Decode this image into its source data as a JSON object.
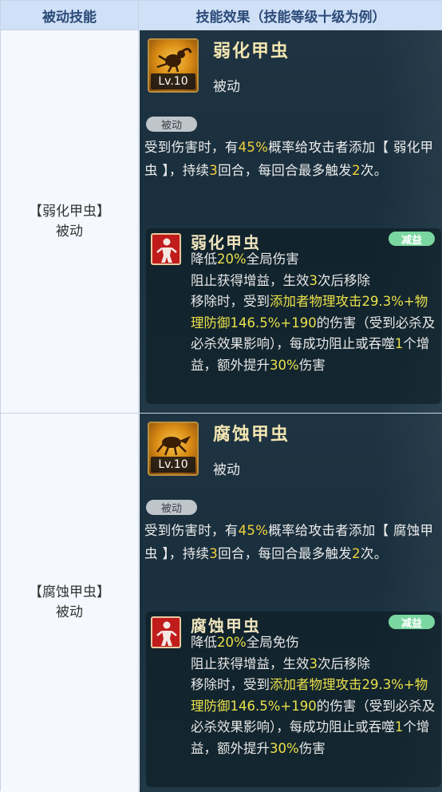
{
  "headers": {
    "col1": "被动技能",
    "col2": "技能效果（技能等级十级为例）"
  },
  "rows": [
    {
      "left_name": "【弱化甲虫】",
      "left_type": "被动",
      "skill_name": "弱化甲虫",
      "level": "Lv.10",
      "skill_type": "被动",
      "tag": "被动",
      "desc": {
        "p1": "受到伤害时，有",
        "v1": "45%",
        "p2": "概率给攻击者添加【 弱化甲虫 】，持续",
        "v2": "3",
        "p3": "回合，每回合最多触发",
        "v3": "2",
        "p4": "次。"
      },
      "buff": {
        "name": "弱化甲虫",
        "badge": "减益",
        "l1a": "降低",
        "l1v": "20%",
        "l1b": "全局伤害",
        "l2a": "阻止获得增益，生效",
        "l2v": "3",
        "l2b": "次后移除",
        "l3a": "移除时，受到",
        "l3v": "添加者物理攻击29.3%+物理防御146.5%+190",
        "l3b": "的伤害（受到必杀及必杀效果影响），每成功阻止或吞噬",
        "l3v2": "1",
        "l3c": "个增益，额外提升",
        "l3v3": "30%",
        "l3d": "伤害"
      }
    },
    {
      "left_name": "【腐蚀甲虫】",
      "left_type": "被动",
      "skill_name": "腐蚀甲虫",
      "level": "Lv.10",
      "skill_type": "被动",
      "tag": "被动",
      "desc": {
        "p1": "受到伤害时，有",
        "v1": "45%",
        "p2": "概率给攻击者添加【 腐蚀甲虫 】，持续",
        "v2": "3",
        "p3": "回合，每回合最多触发",
        "v3": "2",
        "p4": "次。"
      },
      "buff": {
        "name": "腐蚀甲虫",
        "badge": "减益",
        "l1a": "降低",
        "l1v": "20%",
        "l1b": "全局免伤",
        "l2a": "阻止获得增益，生效",
        "l2v": "3",
        "l2b": "次后移除",
        "l3a": "移除时，受到",
        "l3v": "添加者物理攻击29.3%+物理防御146.5%+190",
        "l3b": "的伤害（受到必杀及必杀效果影响），每成功阻止或吞噬",
        "l3v2": "1",
        "l3c": "个增益，额外提升",
        "l3v3": "30%",
        "l3d": "伤害"
      }
    }
  ],
  "colors": {
    "header_bg": "#cfe0f7",
    "panel_bg": "#1f3442",
    "highlight": "#f2d23c",
    "badge": "#7ad7a0"
  }
}
